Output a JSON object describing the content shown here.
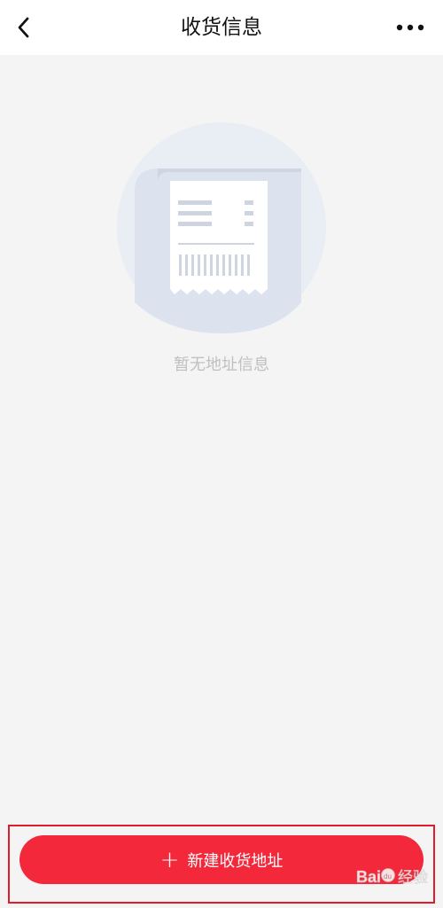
{
  "header": {
    "title": "收货信息",
    "back_icon": "chevron-left-icon",
    "more_icon": "more-horizontal-icon"
  },
  "empty_state": {
    "illustration": "receipt-illustration",
    "message": "暂无地址信息"
  },
  "footer": {
    "add_icon": "plus-icon",
    "add_label": "新建收货地址",
    "accent_color": "#f3283a"
  },
  "watermark": {
    "brand": "Bai du",
    "text": "经验"
  }
}
